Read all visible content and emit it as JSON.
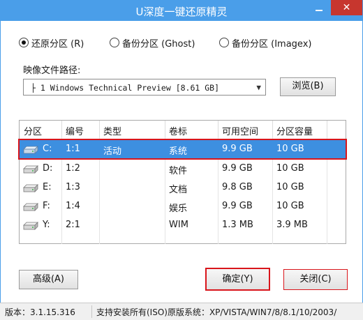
{
  "window": {
    "title": "U深度一键还原精灵"
  },
  "modes": [
    {
      "label": "还原分区 (R)",
      "checked": true
    },
    {
      "label": "备份分区 (Ghost)",
      "checked": false
    },
    {
      "label": "备份分区 (Imagex)",
      "checked": false
    }
  ],
  "image": {
    "path_label": "映像文件路径:",
    "selected": "├ 1 Windows Technical Preview [8.61 GB]",
    "browse_label": "浏览(B)"
  },
  "partitions": {
    "columns": [
      "分区",
      "编号",
      "类型",
      "卷标",
      "可用空间",
      "分区容量"
    ],
    "rows": [
      {
        "drive": "C:",
        "num": "1:1",
        "type": "活动",
        "label": "系统",
        "free": "9.9 GB",
        "size": "10 GB",
        "selected": true
      },
      {
        "drive": "D:",
        "num": "1:2",
        "type": "",
        "label": "软件",
        "free": "9.9 GB",
        "size": "10 GB",
        "selected": false
      },
      {
        "drive": "E:",
        "num": "1:3",
        "type": "",
        "label": "文档",
        "free": "9.8 GB",
        "size": "10 GB",
        "selected": false
      },
      {
        "drive": "F:",
        "num": "1:4",
        "type": "",
        "label": "娱乐",
        "free": "9.9 GB",
        "size": "10 GB",
        "selected": false
      },
      {
        "drive": "Y:",
        "num": "2:1",
        "type": "",
        "label": "WIM",
        "free": "1.3 MB",
        "size": "3.9 MB",
        "selected": false
      }
    ]
  },
  "buttons": {
    "advanced": "高级(A)",
    "ok": "确定(Y)",
    "close": "关闭(C)"
  },
  "status": {
    "version": "版本：3.1.15.316",
    "support": "支持安装所有(ISO)原版系统：XP/VISTA/WIN7/8/8.1/10/2003/"
  },
  "colors": {
    "titlebar": "#4a9ee9",
    "selection": "#3d8fe0",
    "highlight_border": "#d9151b"
  }
}
